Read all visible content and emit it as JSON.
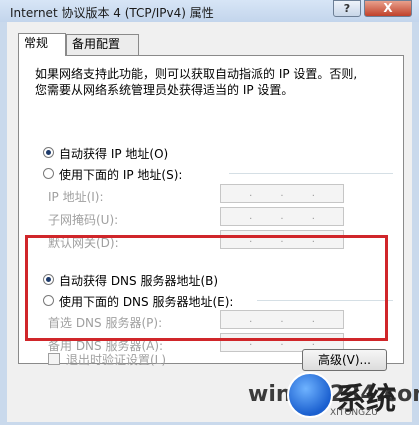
{
  "window": {
    "title": "Internet 协议版本 4 (TCP/IPv4) 属性",
    "help_glyph": "?",
    "close_glyph": "X"
  },
  "tabs": [
    {
      "label": "常规",
      "active": true
    },
    {
      "label": "备用配置",
      "active": false
    }
  ],
  "description": {
    "line1": "如果网络支持此功能，则可以获取自动指派的 IP 设置。否则,",
    "line2": "您需要从网络系统管理员处获得适当的 IP 设置。"
  },
  "ip_section": {
    "auto_label": "自动获得 IP 地址(O)",
    "manual_label": "使用下面的 IP 地址(S):",
    "selected": "auto",
    "fields": [
      {
        "label": "IP 地址(I):"
      },
      {
        "label": "子网掩码(U):"
      },
      {
        "label": "默认网关(D):"
      }
    ]
  },
  "dns_section": {
    "auto_label": "自动获得 DNS 服务器地址(B)",
    "manual_label": "使用下面的 DNS 服务器地址(E):",
    "selected": "auto",
    "fields": [
      {
        "label": "首选 DNS 服务器(P):"
      },
      {
        "label": "备用 DNS 服务器(A):"
      }
    ]
  },
  "footer": {
    "validate_label": "退出时验证设置(L)",
    "advanced_label": "高级(V)..."
  },
  "watermark": {
    "text": "win7 1234.com",
    "logo_text": "系统",
    "sub": "XITONGZU"
  },
  "colors": {
    "highlight_border": "#d0262a",
    "titlebar": "#c9d9ec"
  }
}
